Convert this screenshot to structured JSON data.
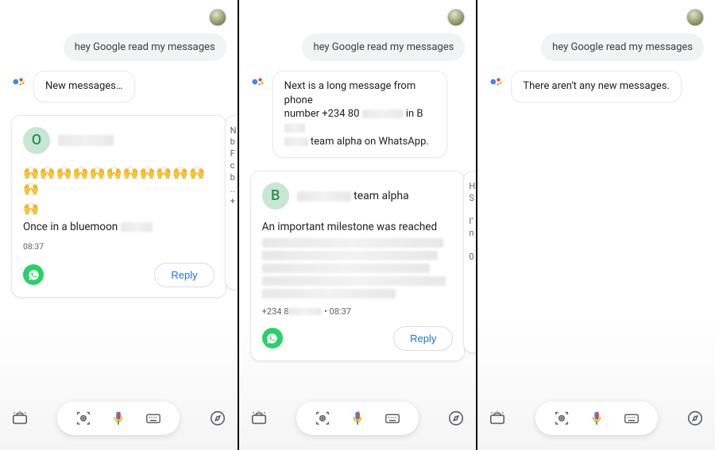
{
  "user_query": "hey Google read my messages",
  "panel1": {
    "assistant_text": "New messages…",
    "card": {
      "avatar_letter": "O",
      "avatar_bg": "#b8e0c8",
      "avatar_fg": "#2e8b57",
      "emoji_line": "🙌🙌🙌🙌🙌🙌🙌🙌🙌🙌🙌🙌",
      "emoji_tail": "🙌",
      "body_prefix": "Once in a bluemoon",
      "timestamp": "08:37",
      "reply": "Reply"
    },
    "peek": "N\nb\nF\nc\nb\n..\n+"
  },
  "panel2": {
    "assistant_text_l1": "Next is a long message from phone",
    "assistant_text_l2": "number +234 80",
    "assistant_text_l3": "in B",
    "assistant_text_l4": "team alpha on WhatsApp.",
    "card": {
      "avatar_letter": "B",
      "avatar_bg": "#b8e0c8",
      "avatar_fg": "#2e8b57",
      "name_suffix": "team alpha",
      "body_l1": "An important milestone was reached",
      "meta_prefix": "+234 8",
      "meta_sep": " • ",
      "meta_time": "08:37",
      "reply": "Reply"
    },
    "peek": "H\nS\n\nI'\nn\n\n0"
  },
  "panel3": {
    "assistant_text": "There aren't any new messages."
  },
  "icons": {
    "snapshot": "snapshot-icon",
    "lens": "lens-icon",
    "mic": "mic-icon",
    "keyboard": "keyboard-icon",
    "explore": "explore-icon"
  }
}
